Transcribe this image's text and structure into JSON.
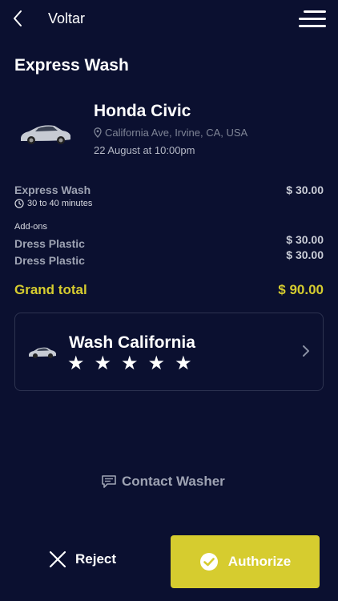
{
  "header": {
    "back_icon": "chevron-left-icon",
    "title": "Voltar",
    "menu_icon": "hamburger-menu-icon"
  },
  "page": {
    "title": "Express Wash"
  },
  "vehicle": {
    "name": "Honda Civic",
    "location": "California Ave, Irvine, CA, USA",
    "datetime": "22 August at 10:00pm",
    "image": "silver-sedan-image"
  },
  "summary": {
    "service_name": "Express Wash",
    "service_price": "$ 30.00",
    "service_duration": "30 to 40 minutes",
    "addons_label": "Add-ons",
    "addons": [
      {
        "label": "Dress Plastic",
        "price": "$ 30.00"
      },
      {
        "label": "Dress Plastic",
        "price": "$ 30.00"
      }
    ],
    "total_label": "Grand total",
    "total_value": "$ 90.00"
  },
  "washer": {
    "name": "Wash California",
    "rating": 5,
    "max_rating": 5
  },
  "actions": {
    "contact_label": "Contact Washer",
    "reject_label": "Reject",
    "authorize_label": "Authorize"
  },
  "colors": {
    "background": "#0b1030",
    "accent": "#d6cc2f",
    "muted_text": "#9ea3b3"
  }
}
